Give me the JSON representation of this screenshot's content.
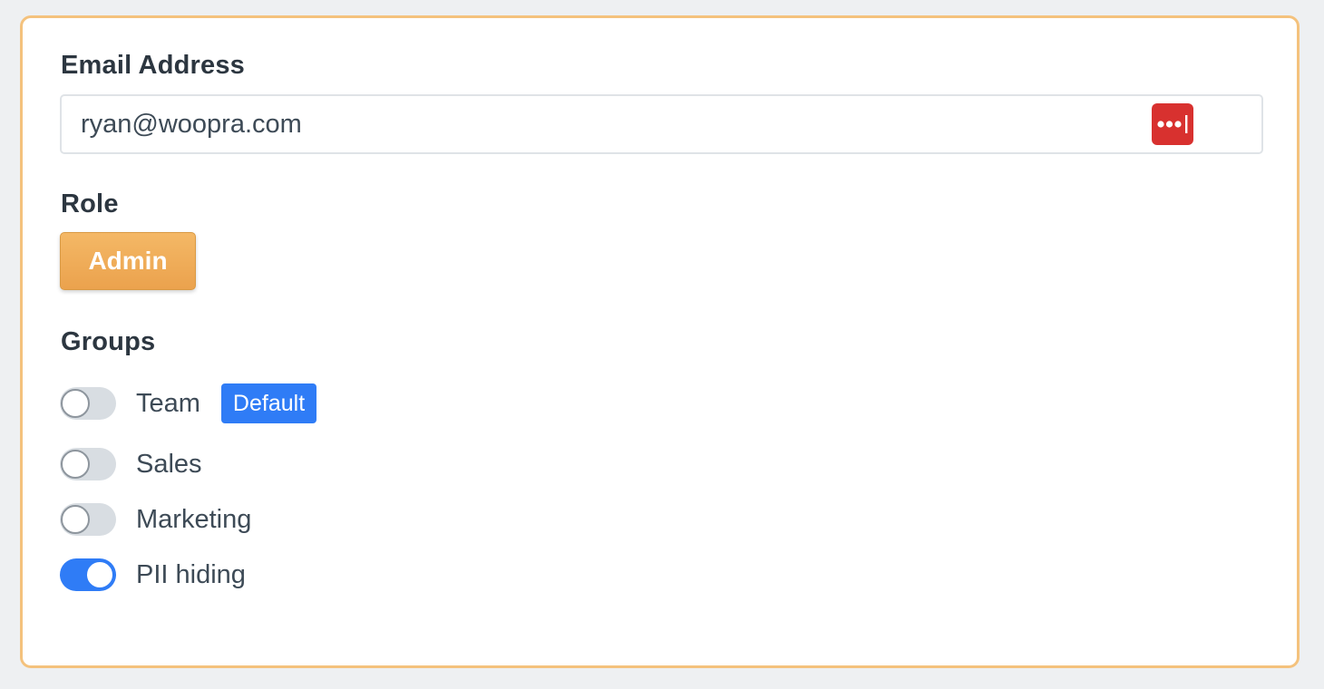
{
  "form": {
    "email": {
      "label": "Email Address",
      "value": "ryan@woopra.com",
      "password_manager_icon": "password-manager-icon",
      "password_manager_color": "#d8312f"
    },
    "role": {
      "label": "Role",
      "selected": "Admin",
      "button_color": "#eba24d"
    },
    "groups": {
      "label": "Groups",
      "items": [
        {
          "label": "Team",
          "enabled": false,
          "badge": "Default"
        },
        {
          "label": "Sales",
          "enabled": false
        },
        {
          "label": "Marketing",
          "enabled": false
        },
        {
          "label": "PII hiding",
          "enabled": true
        }
      ],
      "toggle_on_color": "#2f7cf6",
      "toggle_off_color": "#d8dde2"
    }
  },
  "colors": {
    "card_border": "#f4c27d",
    "badge": "#2f7cf6"
  }
}
